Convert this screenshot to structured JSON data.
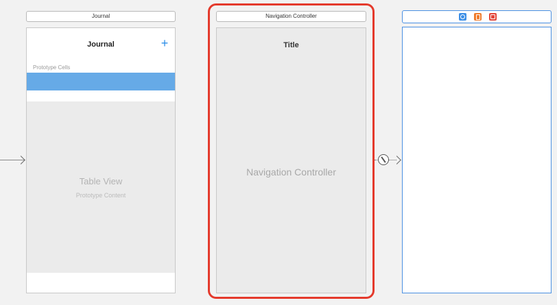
{
  "journal_scene": {
    "title": "Journal",
    "nav_title": "Journal",
    "add_icon_glyph": "+",
    "section_header": "Prototype Cells",
    "table_placeholder_title": "Table View",
    "table_placeholder_subtitle": "Prototype Content"
  },
  "navigation_scene": {
    "title": "Navigation Controller",
    "nav_title": "Title",
    "placeholder": "Navigation Controller"
  },
  "third_scene": {
    "dock_icons": [
      "view-controller-icon",
      "first-responder-icon",
      "exit-icon"
    ]
  },
  "colors": {
    "selection_outline": "#e43a2c",
    "accent_blue": "#2f8fe8",
    "cell_highlight": "#66aae7",
    "selected_scene_border": "#4a90e2"
  }
}
